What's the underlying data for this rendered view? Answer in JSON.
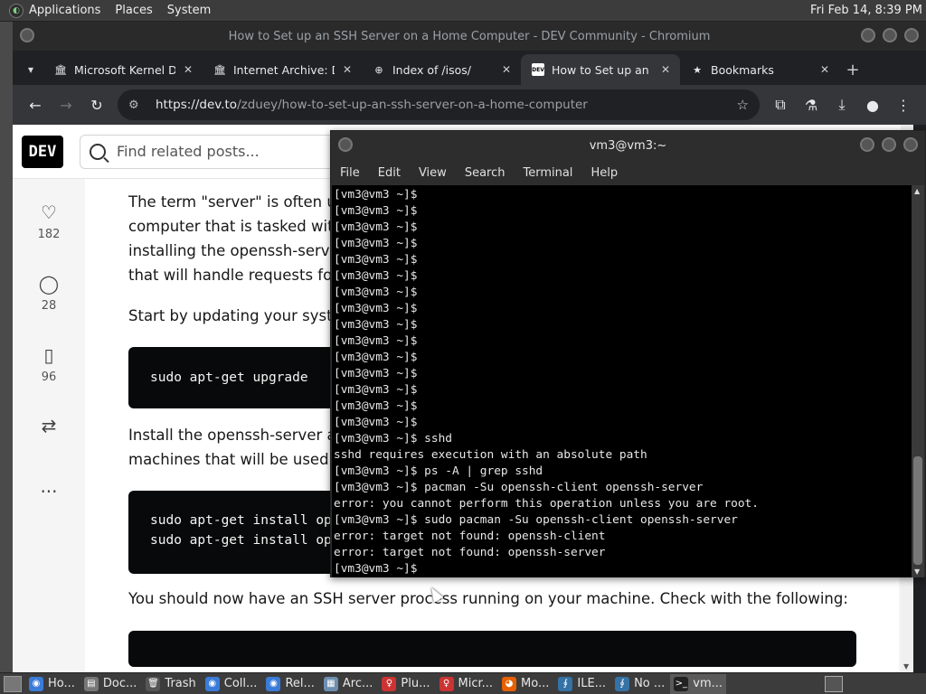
{
  "top_panel": {
    "menus": [
      "Applications",
      "Places",
      "System"
    ],
    "clock": "Fri Feb 14,  8:39 PM"
  },
  "browser": {
    "window_title": "How to Set up an SSH Server on a Home Computer - DEV Community - Chromium",
    "tabs": [
      {
        "title": "Microsoft Kernel D",
        "icon": "archive-icon",
        "active": false
      },
      {
        "title": "Internet Archive: D",
        "icon": "archive-icon",
        "active": false
      },
      {
        "title": "Index of /isos/",
        "icon": "globe-icon",
        "active": false
      },
      {
        "title": "How to Set up an",
        "icon": "dev-icon",
        "active": true
      },
      {
        "title": "Bookmarks",
        "icon": "star-icon",
        "active": false
      }
    ],
    "url_host": "https://dev.to",
    "url_path": "/zduey/how-to-set-up-an-ssh-server-on-a-home-computer"
  },
  "page": {
    "logo": "DEV",
    "search_placeholder": "Find related posts...",
    "reactions": {
      "likes": "182",
      "comments": "28",
      "bookmarks": "96"
    },
    "paragraphs": [
      "The term \"server\" is often us",
      "computer that is tasked with",
      "installing the openssh-serve",
      "that will handle requests for",
      "Start by updating your syste",
      "Install the openssh-server a",
      "machines that will be used a",
      "You should now have an SSH server process running on your machine. Check with the following:"
    ],
    "code_blocks": [
      [
        "sudo apt-get upgrade"
      ],
      [
        "sudo apt-get install op",
        "sudo apt-get install op"
      ]
    ]
  },
  "terminal": {
    "title": "vm3@vm3:~",
    "menus": [
      "File",
      "Edit",
      "View",
      "Search",
      "Terminal",
      "Help"
    ],
    "lines": [
      "[vm3@vm3 ~]$",
      "[vm3@vm3 ~]$",
      "[vm3@vm3 ~]$",
      "[vm3@vm3 ~]$",
      "[vm3@vm3 ~]$",
      "[vm3@vm3 ~]$",
      "[vm3@vm3 ~]$",
      "[vm3@vm3 ~]$",
      "[vm3@vm3 ~]$",
      "[vm3@vm3 ~]$",
      "[vm3@vm3 ~]$",
      "[vm3@vm3 ~]$",
      "[vm3@vm3 ~]$",
      "[vm3@vm3 ~]$",
      "[vm3@vm3 ~]$",
      "[vm3@vm3 ~]$ sshd",
      "sshd requires execution with an absolute path",
      "[vm3@vm3 ~]$ ps -A | grep sshd",
      "[vm3@vm3 ~]$ pacman -Su openssh-client openssh-server",
      "error: you cannot perform this operation unless you are root.",
      "[vm3@vm3 ~]$ sudo pacman -Su openssh-client openssh-server",
      "error: target not found: openssh-client",
      "error: target not found: openssh-server",
      "[vm3@vm3 ~]$ "
    ]
  },
  "taskbar": {
    "items": [
      {
        "label": "Ho...",
        "icon": "chromium-icon",
        "color": "#3b7bd8"
      },
      {
        "label": "Doc...",
        "icon": "folder-icon",
        "color": "#777"
      },
      {
        "label": "Trash",
        "icon": "trash-icon",
        "color": "#555"
      },
      {
        "label": "Coll...",
        "icon": "chromium-icon",
        "color": "#3b7bd8"
      },
      {
        "label": "Rel...",
        "icon": "chromium-icon",
        "color": "#3b7bd8"
      },
      {
        "label": "Arc...",
        "icon": "archive-manager-icon",
        "color": "#6d8fb0"
      },
      {
        "label": "Plu...",
        "icon": "pin-icon",
        "color": "#c33"
      },
      {
        "label": "Micr...",
        "icon": "pin-icon",
        "color": "#c33"
      },
      {
        "label": "Mo...",
        "icon": "firefox-icon",
        "color": "#e66000"
      },
      {
        "label": "ILE...",
        "icon": "python-icon",
        "color": "#3572a5"
      },
      {
        "label": "No ...",
        "icon": "python-icon",
        "color": "#3572a5"
      },
      {
        "label": "vm...",
        "icon": "terminal-icon",
        "color": "#222"
      }
    ]
  }
}
